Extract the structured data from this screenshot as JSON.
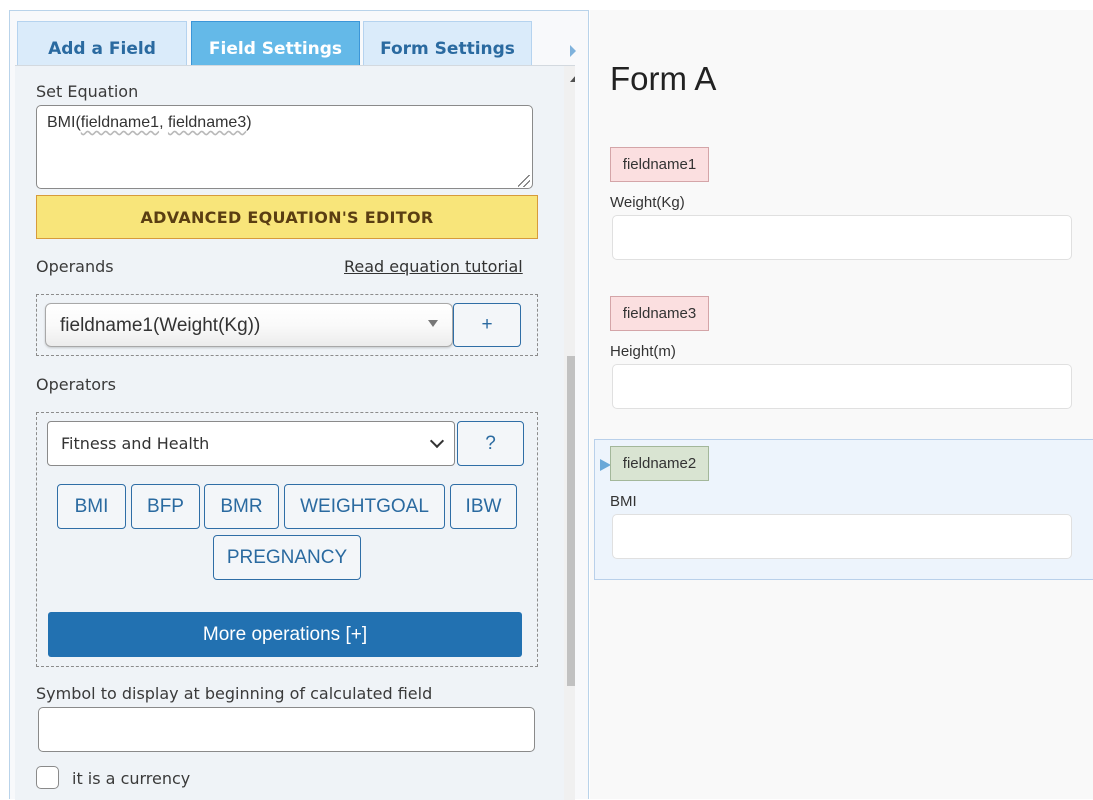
{
  "tabs": [
    {
      "label": "Add a Field",
      "active": false
    },
    {
      "label": "Field Settings",
      "active": true
    },
    {
      "label": "Form Settings",
      "active": false
    }
  ],
  "icons": {
    "tab_scroll": "triangle-right-icon",
    "scroll_up": "triangle-up-icon",
    "select_caret": "triangle-down-icon",
    "select_chevron": "chevron-down-icon",
    "selected_field": "triangle-right-icon"
  },
  "settings": {
    "equation_label": "Set Equation",
    "equation_value": {
      "prefix": "BMI(",
      "arg1": "fieldname1",
      "sep": ", ",
      "arg2": "fieldname3",
      "suffix": ")"
    },
    "advanced_editor_label": "ADVANCED EQUATION'S EDITOR",
    "operands_label": "Operands",
    "tutorial_link": "Read equation tutorial",
    "operand_selected": "fieldname1(Weight(Kg))",
    "add_operand_label": "+",
    "operators_label": "Operators",
    "operator_category": "Fitness and Health",
    "help_label": "?",
    "operators": [
      "BMI",
      "BFP",
      "BMR",
      "WEIGHTGOAL",
      "IBW",
      "PREGNANCY"
    ],
    "more_operations_label": "More operations [+]",
    "symbol_label": "Symbol to display at beginning of calculated field",
    "symbol_value": "",
    "currency_label": "it is a currency",
    "currency_checked": false
  },
  "colors": {
    "tab_active": "#64b9e8",
    "tab_inactive": "#daebfa",
    "advanced_btn": "#f8e57a",
    "primary_btn": "#2271b1",
    "badge_red": "#fbdfe0",
    "badge_green": "#d9e4d2",
    "selected_bg": "#edf4fc"
  },
  "preview": {
    "form_title": "Form A",
    "fields": [
      {
        "name": "fieldname1",
        "label": "Weight(Kg)",
        "value": "",
        "selected": false
      },
      {
        "name": "fieldname3",
        "label": "Height(m)",
        "value": "",
        "selected": false
      },
      {
        "name": "fieldname2",
        "label": "BMI",
        "value": "",
        "selected": true
      }
    ]
  }
}
